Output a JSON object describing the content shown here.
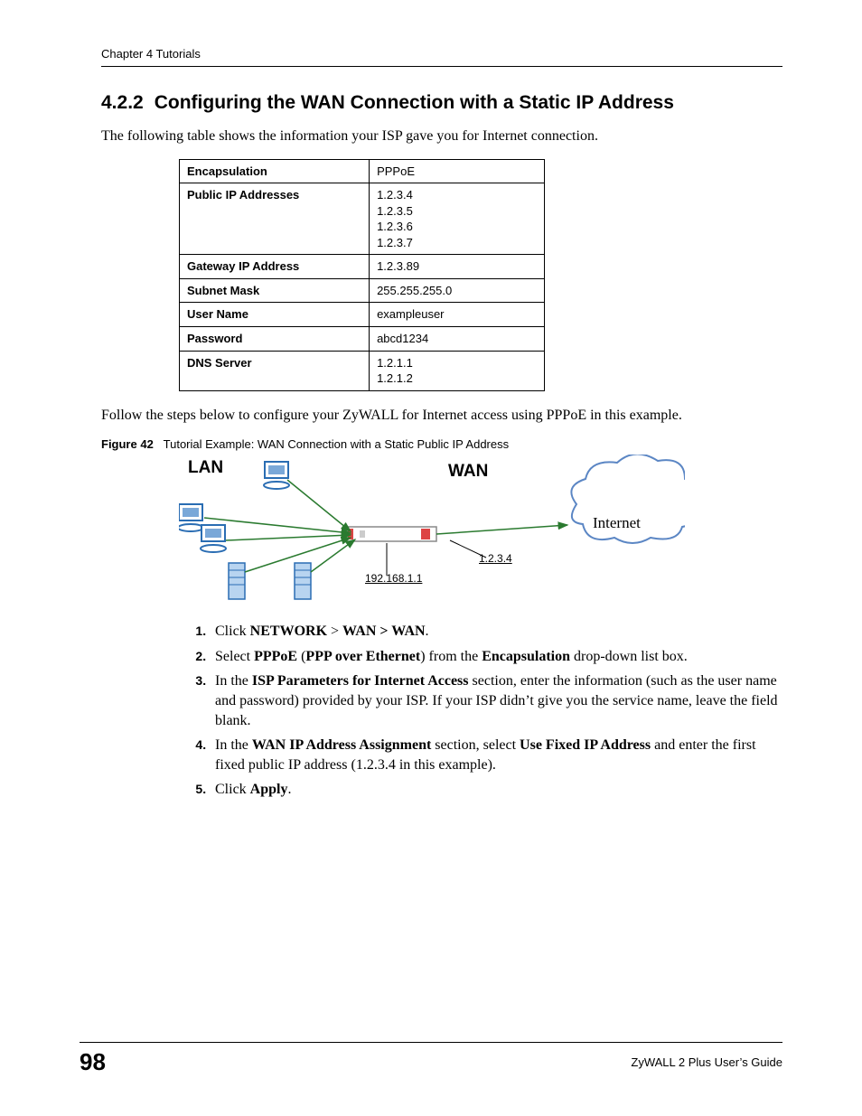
{
  "header": {
    "running": "Chapter 4 Tutorials"
  },
  "section": {
    "number": "4.2.2",
    "title": "Configuring the WAN Connection with a Static IP Address",
    "intro": "The following table shows the information your ISP gave you for Internet connection."
  },
  "table": {
    "rows": [
      {
        "label": "Encapsulation",
        "value": "PPPoE"
      },
      {
        "label": "Public IP Addresses",
        "value": "1.2.3.4\n1.2.3.5\n1.2.3.6\n1.2.3.7"
      },
      {
        "label": "Gateway IP Address",
        "value": "1.2.3.89"
      },
      {
        "label": "Subnet Mask",
        "value": "255.255.255.0"
      },
      {
        "label": "User Name",
        "value": "exampleuser"
      },
      {
        "label": "Password",
        "value": "abcd1234"
      },
      {
        "label": "DNS Server",
        "value": "1.2.1.1\n1.2.1.2"
      }
    ]
  },
  "follow_text": "Follow the steps below to configure your ZyWALL for Internet access using PPPoE in this example.",
  "figure": {
    "label": "Figure 42",
    "caption": "Tutorial Example: WAN Connection with a Static Public IP Address",
    "lan": "LAN",
    "wan": "WAN",
    "internet": "Internet",
    "router_ip": "192.168.1.1",
    "public_ip": "1.2.3.4"
  },
  "steps": {
    "s1": {
      "b1": "NETWORK",
      "gt": ">",
      "b2": "WAN > WAN",
      "pre": "Click ",
      "post": "."
    },
    "s2": {
      "pre": "Select ",
      "b1": "PPPoE",
      "mid1": " (",
      "b2": "PPP over Ethernet",
      "mid2": ") from the ",
      "b3": "Encapsulation",
      "post": " drop-down list box."
    },
    "s3": {
      "pre": "In the ",
      "b1": "ISP Parameters for Internet Access",
      "post": " section, enter the information (such as the user name and password) provided by your ISP. If your ISP didn’t give you the service name, leave the field blank."
    },
    "s4": {
      "pre": "In the ",
      "b1": "WAN IP Address Assignment",
      "mid": " section, select ",
      "b2": "Use Fixed IP Address",
      "post": " and enter the first fixed public IP address (1.2.3.4 in this example)."
    },
    "s5": {
      "pre": "Click ",
      "b1": "Apply",
      "post": "."
    }
  },
  "footer": {
    "page": "98",
    "guide": "ZyWALL 2 Plus User’s Guide"
  }
}
